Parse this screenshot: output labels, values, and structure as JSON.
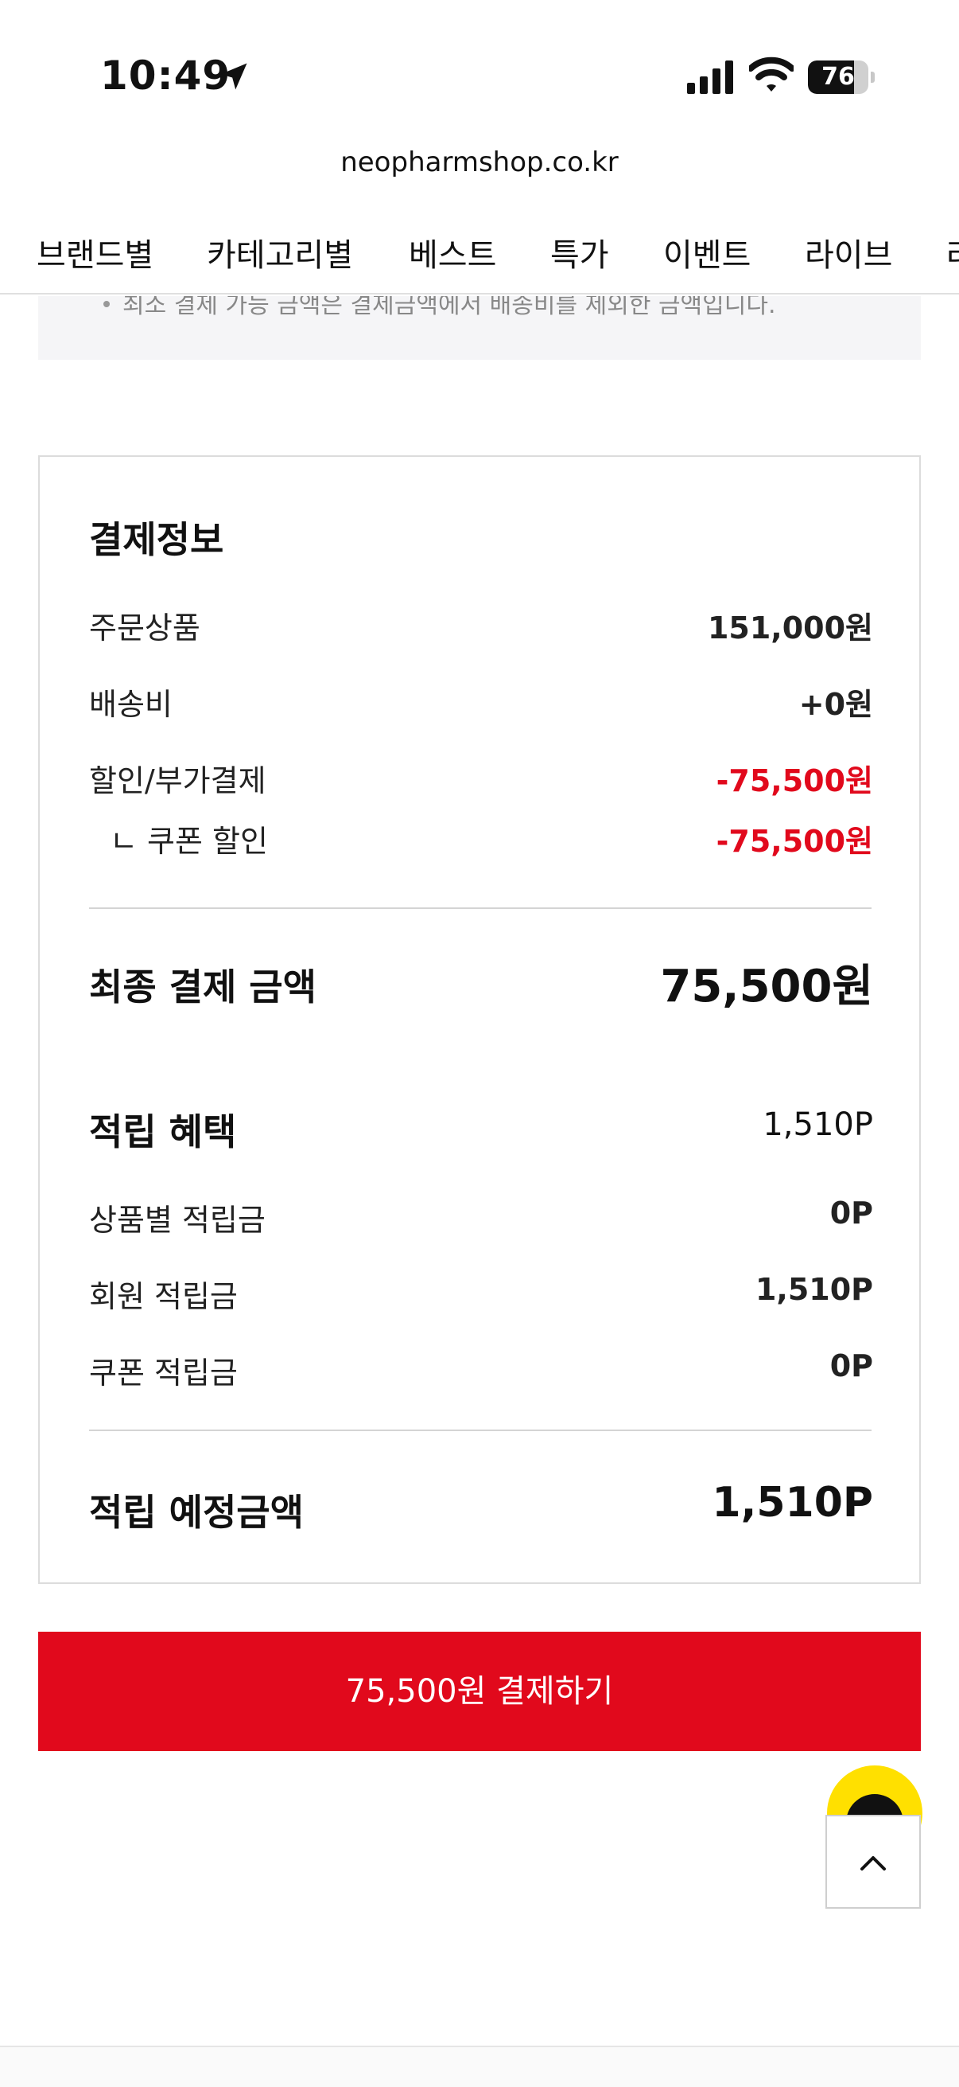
{
  "status_bar": {
    "time": "10:49",
    "battery_level": "76",
    "battery_fraction": 0.76
  },
  "browser": {
    "url": "neopharmshop.co.kr"
  },
  "nav": {
    "items": [
      "브랜드별",
      "카테고리별",
      "베스트",
      "특가",
      "이벤트",
      "라이브",
      "라"
    ]
  },
  "notice": {
    "text": "최소 결제 가능 금액은 결제금액에서 배송비를 제외한 금액입니다."
  },
  "payment": {
    "title": "결제정보",
    "rows": [
      {
        "label": "주문상품",
        "value": "151,000원"
      },
      {
        "label": "배송비",
        "value": "+0원"
      },
      {
        "label": "할인/부가결제",
        "value": "-75,500원"
      },
      {
        "label": "ㄴ 쿠폰 할인",
        "value": "-75,500원"
      }
    ],
    "final_label": "최종 결제 금액",
    "final_value": "75,500원"
  },
  "points": {
    "title": "적립 혜택",
    "total": "1,510P",
    "rows": [
      {
        "label": "상품별 적립금",
        "value": "0P"
      },
      {
        "label": "회원 적립금",
        "value": "1,510P"
      },
      {
        "label": "쿠폰 적립금",
        "value": "0P"
      }
    ],
    "expected_label": "적립 예정금액",
    "expected_value": "1,510P"
  },
  "pay_button": {
    "label": "75,500원 결제하기"
  },
  "colors": {
    "accent_red": "#e1091c",
    "chat_yellow": "#ffe000"
  },
  "icons": {
    "location": "location-arrow-icon",
    "signal": "cellular-signal-icon",
    "wifi": "wifi-icon",
    "battery": "battery-icon",
    "scroll_top": "chevron-up-icon",
    "chat": "chat-bubble-icon"
  }
}
